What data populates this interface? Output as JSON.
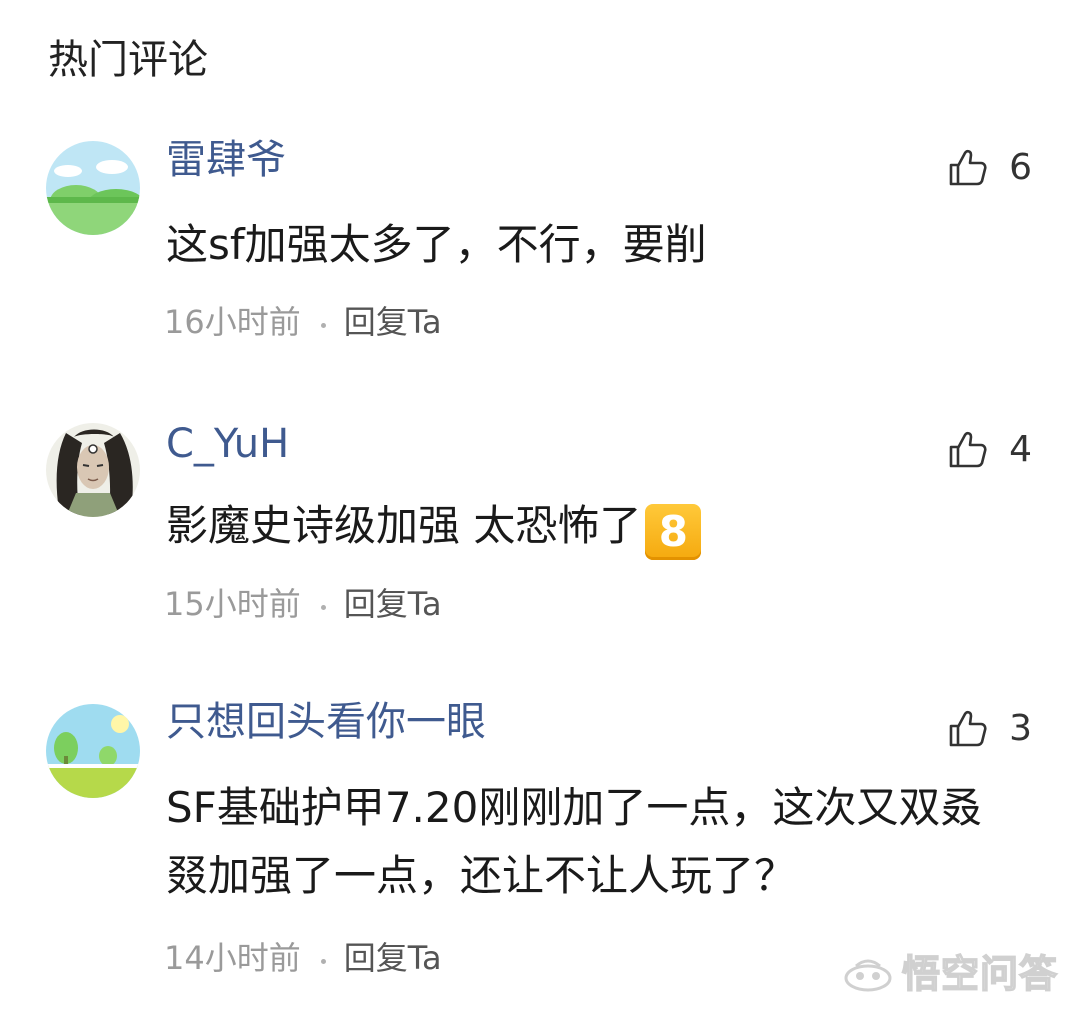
{
  "header": {
    "title": "热门评论"
  },
  "comments": [
    {
      "avatar_icon": "landscape-avatar-icon",
      "username": "雷肆爷",
      "like_count": "6",
      "content": "这sf加强太多了，不行，要削",
      "emoji": "",
      "time": "16小时前",
      "reply_label": "回复Ta"
    },
    {
      "avatar_icon": "anime-character-avatar-icon",
      "username": "C_YuH",
      "like_count": "4",
      "content": "影魔史诗级加强 太恐怖了",
      "emoji": "8",
      "time": "15小时前",
      "reply_label": "回复Ta"
    },
    {
      "avatar_icon": "landscape-avatar-icon",
      "username": "只想回头看你一眼",
      "like_count": "3",
      "content": "SF基础护甲7.20刚刚加了一点，这次又双叒叕加强了一点，还让不让人玩了？",
      "emoji": "",
      "time": "14小时前",
      "reply_label": "回复Ta"
    }
  ],
  "watermark": {
    "text": "悟空问答",
    "icon": "wukong-logo-icon"
  },
  "colors": {
    "username": "#3f5a8f",
    "meta": "#9a9a9a",
    "emoji_bg": "#f5a90e"
  }
}
